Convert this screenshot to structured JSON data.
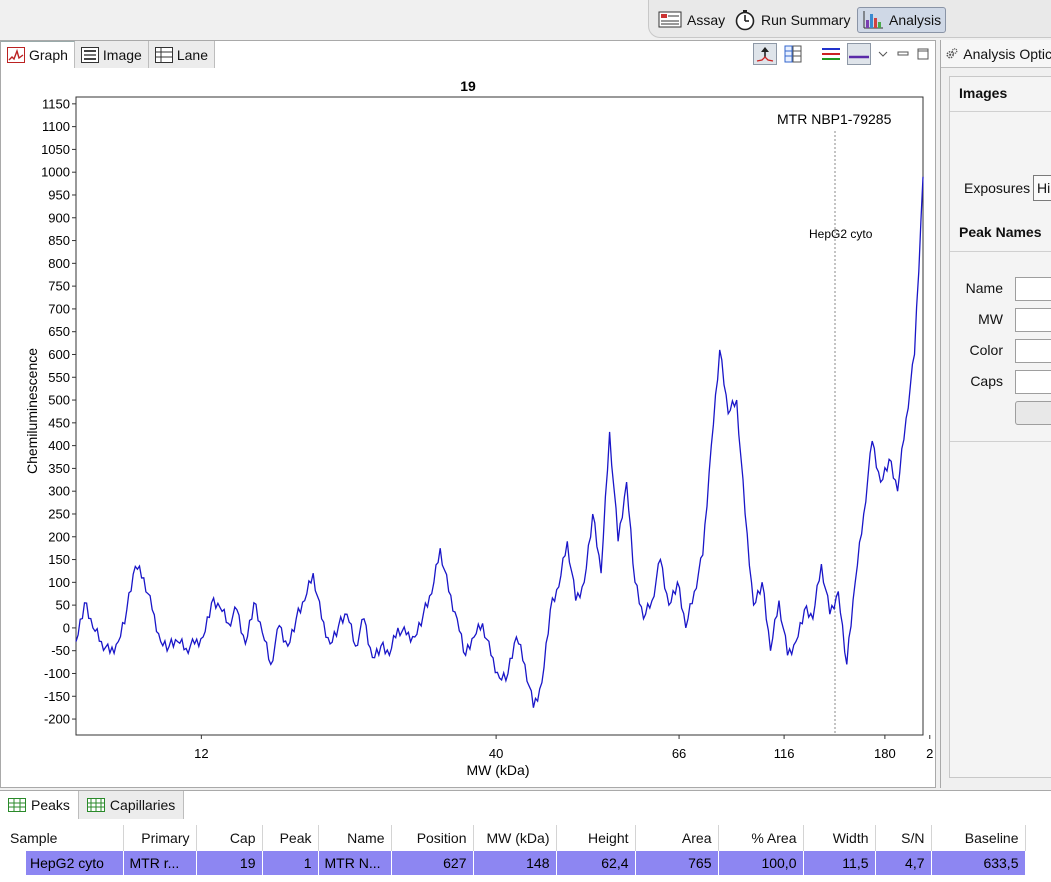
{
  "perspectives": [
    {
      "label": "Assay",
      "icon": "assay-icon",
      "active": false
    },
    {
      "label": "Run Summary",
      "icon": "stopwatch-icon",
      "active": false
    },
    {
      "label": "Analysis",
      "icon": "analysis-icon",
      "active": true
    }
  ],
  "graph_tabs": [
    {
      "label": "Graph",
      "icon": "graph-icon",
      "active": true
    },
    {
      "label": "Image",
      "icon": "image-icon",
      "active": false
    },
    {
      "label": "Lane",
      "icon": "lane-icon",
      "active": false
    }
  ],
  "right_panel": {
    "tab_label": "Analysis Optic",
    "images_title": "Images",
    "exposures_label": "Exposures",
    "exposures_value": "Hi",
    "peak_names_title": "Peak Names",
    "fields": [
      "Name",
      "MW",
      "Color",
      "Caps"
    ]
  },
  "chart_data": {
    "type": "line",
    "title": "19",
    "annotation": "MTR NBP1-79285",
    "marker_label": "HepG2 cyto",
    "marker_x_kda": 148,
    "xlabel": "MW (kDa)",
    "ylabel": "Chemiluminescence",
    "x_tick_labels": [
      "12",
      "40",
      "66",
      "116",
      "180",
      "2"
    ],
    "y_ticks": [
      1150,
      1100,
      1050,
      1000,
      950,
      900,
      850,
      800,
      750,
      700,
      650,
      600,
      550,
      500,
      450,
      400,
      350,
      300,
      250,
      200,
      150,
      100,
      50,
      0,
      -50,
      -100,
      -150,
      -200
    ],
    "ylim": [
      -235,
      1165
    ],
    "x_scale": "non-linear (ladder calibrated)",
    "x_positions": [
      0,
      0.01,
      0.02,
      0.03,
      0.04,
      0.05,
      0.06,
      0.07,
      0.08,
      0.09,
      0.1,
      0.11,
      0.12,
      0.13,
      0.14,
      0.15,
      0.16,
      0.17,
      0.18,
      0.19,
      0.2,
      0.21,
      0.22,
      0.23,
      0.24,
      0.25,
      0.26,
      0.27,
      0.28,
      0.29,
      0.3,
      0.31,
      0.32,
      0.33,
      0.34,
      0.35,
      0.36,
      0.37,
      0.38,
      0.39,
      0.4,
      0.41,
      0.42,
      0.43,
      0.44,
      0.45,
      0.46,
      0.47,
      0.48,
      0.49,
      0.5,
      0.51,
      0.52,
      0.53,
      0.54,
      0.55,
      0.56,
      0.57,
      0.58,
      0.59,
      0.6,
      0.61,
      0.62,
      0.63,
      0.64,
      0.65,
      0.66,
      0.67,
      0.68,
      0.69,
      0.7,
      0.71,
      0.72,
      0.73,
      0.74,
      0.75,
      0.76,
      0.77,
      0.78,
      0.79,
      0.8,
      0.81,
      0.82,
      0.83,
      0.84,
      0.85,
      0.86,
      0.87,
      0.88,
      0.89,
      0.9,
      0.91,
      0.92,
      0.93,
      0.94,
      0.95,
      0.96,
      0.97,
      0.98,
      0.99,
      1.0
    ],
    "y_values": [
      -30,
      55,
      0,
      -30,
      -55,
      -30,
      40,
      135,
      110,
      40,
      -30,
      -40,
      -30,
      -45,
      -35,
      -20,
      55,
      45,
      10,
      40,
      -35,
      55,
      -10,
      -80,
      5,
      -40,
      20,
      60,
      120,
      20,
      -35,
      5,
      30,
      -40,
      20,
      -65,
      -40,
      -60,
      0,
      -15,
      -20,
      30,
      75,
      175,
      80,
      20,
      -60,
      -20,
      10,
      -60,
      -110,
      -100,
      -20,
      -80,
      -175,
      -120,
      40,
      90,
      190,
      60,
      100,
      250,
      120,
      430,
      190,
      320,
      100,
      20,
      60,
      150,
      50,
      100,
      0,
      80,
      160,
      400,
      610,
      470,
      500,
      250,
      50,
      100,
      -50,
      60,
      -60,
      -30,
      40,
      20,
      140,
      30,
      80,
      -80,
      100,
      250,
      410,
      320,
      370,
      300,
      460,
      600,
      990
    ],
    "colors": {
      "line": "#1a16c8",
      "marker": "#888888"
    }
  },
  "peaks_tabs": [
    {
      "label": "Peaks",
      "icon": "peaks-table-icon",
      "active": true
    },
    {
      "label": "Capillaries",
      "icon": "capillaries-icon",
      "active": false
    }
  ],
  "peaks_table": {
    "columns": [
      "Sample",
      "Primary",
      "Cap",
      "Peak",
      "Name",
      "Position",
      "MW (kDa)",
      "Height",
      "Area",
      "% Area",
      "Width",
      "S/N",
      "Baseline"
    ],
    "rows": [
      [
        "HepG2 cyto",
        "MTR r...",
        "19",
        "1",
        "MTR N...",
        "627",
        "148",
        "62,4",
        "765",
        "100,0",
        "11,5",
        "4,7",
        "633,5"
      ]
    ],
    "selection_color": "#8d86f2"
  }
}
